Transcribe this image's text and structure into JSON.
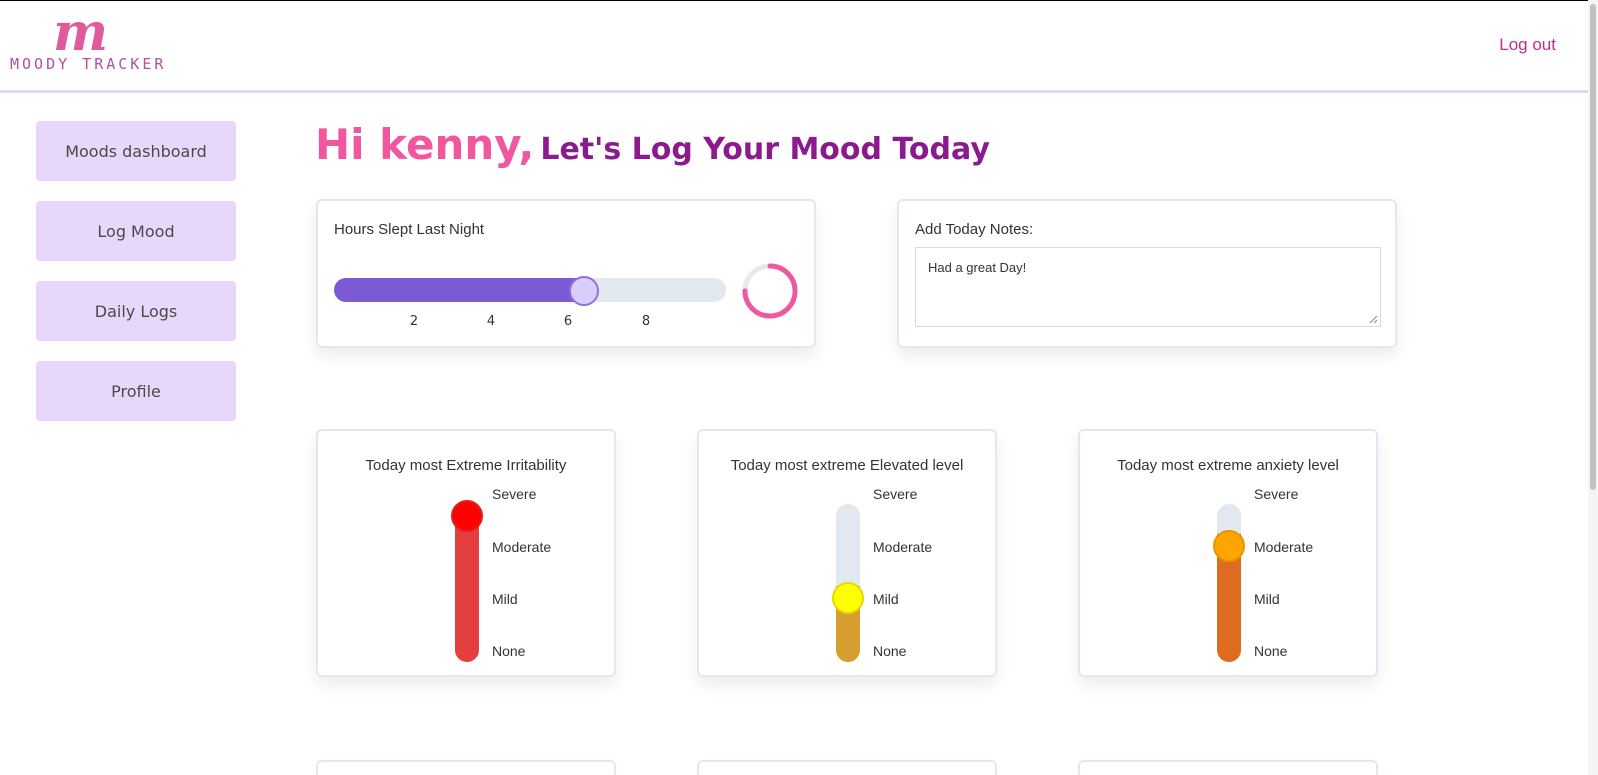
{
  "brand": {
    "logo_letter": "m",
    "logo_text": "MOODY TRACKER"
  },
  "header": {
    "logout_label": "Log out"
  },
  "sidebar": {
    "items": [
      {
        "label": "Moods dashboard"
      },
      {
        "label": "Log Mood"
      },
      {
        "label": "Daily Logs"
      },
      {
        "label": "Profile"
      }
    ]
  },
  "greeting": {
    "hi": "Hi kenny,",
    "subtitle": "Let's Log Your Mood Today"
  },
  "sleep": {
    "title": "Hours Slept Last Night",
    "value": 6,
    "min": 0,
    "max": 10,
    "ticks": [
      "2",
      "4",
      "6",
      "8"
    ]
  },
  "notes": {
    "title": "Add Today Notes:",
    "value": "Had a great Day!"
  },
  "levels": [
    "Severe",
    "Moderate",
    "Mild",
    "None"
  ],
  "moods": [
    {
      "title": "Today most Extreme Irritability",
      "level_index": 3,
      "fill_color": "#e53e3e",
      "thumb_color": "#ff0000",
      "thumb_border": "#e02020"
    },
    {
      "title": "Today most extreme Elevated level",
      "level_index": 1,
      "fill_color": "#d69e2e",
      "thumb_color": "#ffff00",
      "thumb_border": "#e6d800"
    },
    {
      "title": "Today most extreme anxiety level",
      "level_index": 2,
      "fill_color": "#dd6b20",
      "thumb_color": "#ffa500",
      "thumb_border": "#e69500"
    }
  ],
  "colors": {
    "accent_pink": "#f0579e",
    "accent_purple": "#8b1a8e",
    "nav_bg": "#e7d7fb",
    "slider_fill": "#7c5ad6"
  }
}
